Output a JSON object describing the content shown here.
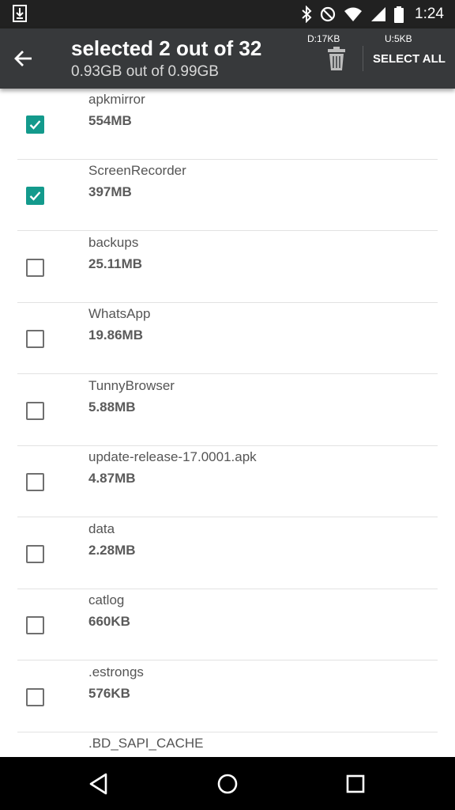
{
  "status_bar": {
    "time": "1:24",
    "icons": [
      "download-icon",
      "bluetooth-icon",
      "do-not-disturb-icon",
      "wifi-icon",
      "signal-icon",
      "battery-icon"
    ]
  },
  "toolbar": {
    "title": "selected 2 out of 32",
    "subtitle": "0.93GB out of 0.99GB",
    "download_stat": "D:17KB",
    "upload_stat": "U:5KB",
    "select_all_label": "SELECT ALL"
  },
  "files": [
    {
      "name": "apkmirror",
      "size": "554MB",
      "checked": true
    },
    {
      "name": "ScreenRecorder",
      "size": "397MB",
      "checked": true
    },
    {
      "name": "backups",
      "size": "25.11MB",
      "checked": false
    },
    {
      "name": "WhatsApp",
      "size": "19.86MB",
      "checked": false
    },
    {
      "name": "TunnyBrowser",
      "size": "5.88MB",
      "checked": false
    },
    {
      "name": "update-release-17.0001.apk",
      "size": "4.87MB",
      "checked": false
    },
    {
      "name": "data",
      "size": "2.28MB",
      "checked": false
    },
    {
      "name": "catlog",
      "size": "660KB",
      "checked": false
    },
    {
      "name": ".estrongs",
      "size": "576KB",
      "checked": false
    },
    {
      "name": ".BD_SAPI_CACHE",
      "size": "",
      "checked": false
    }
  ],
  "colors": {
    "accent": "#139a8c",
    "toolbar": "#37393b",
    "status_bar": "#212121"
  }
}
